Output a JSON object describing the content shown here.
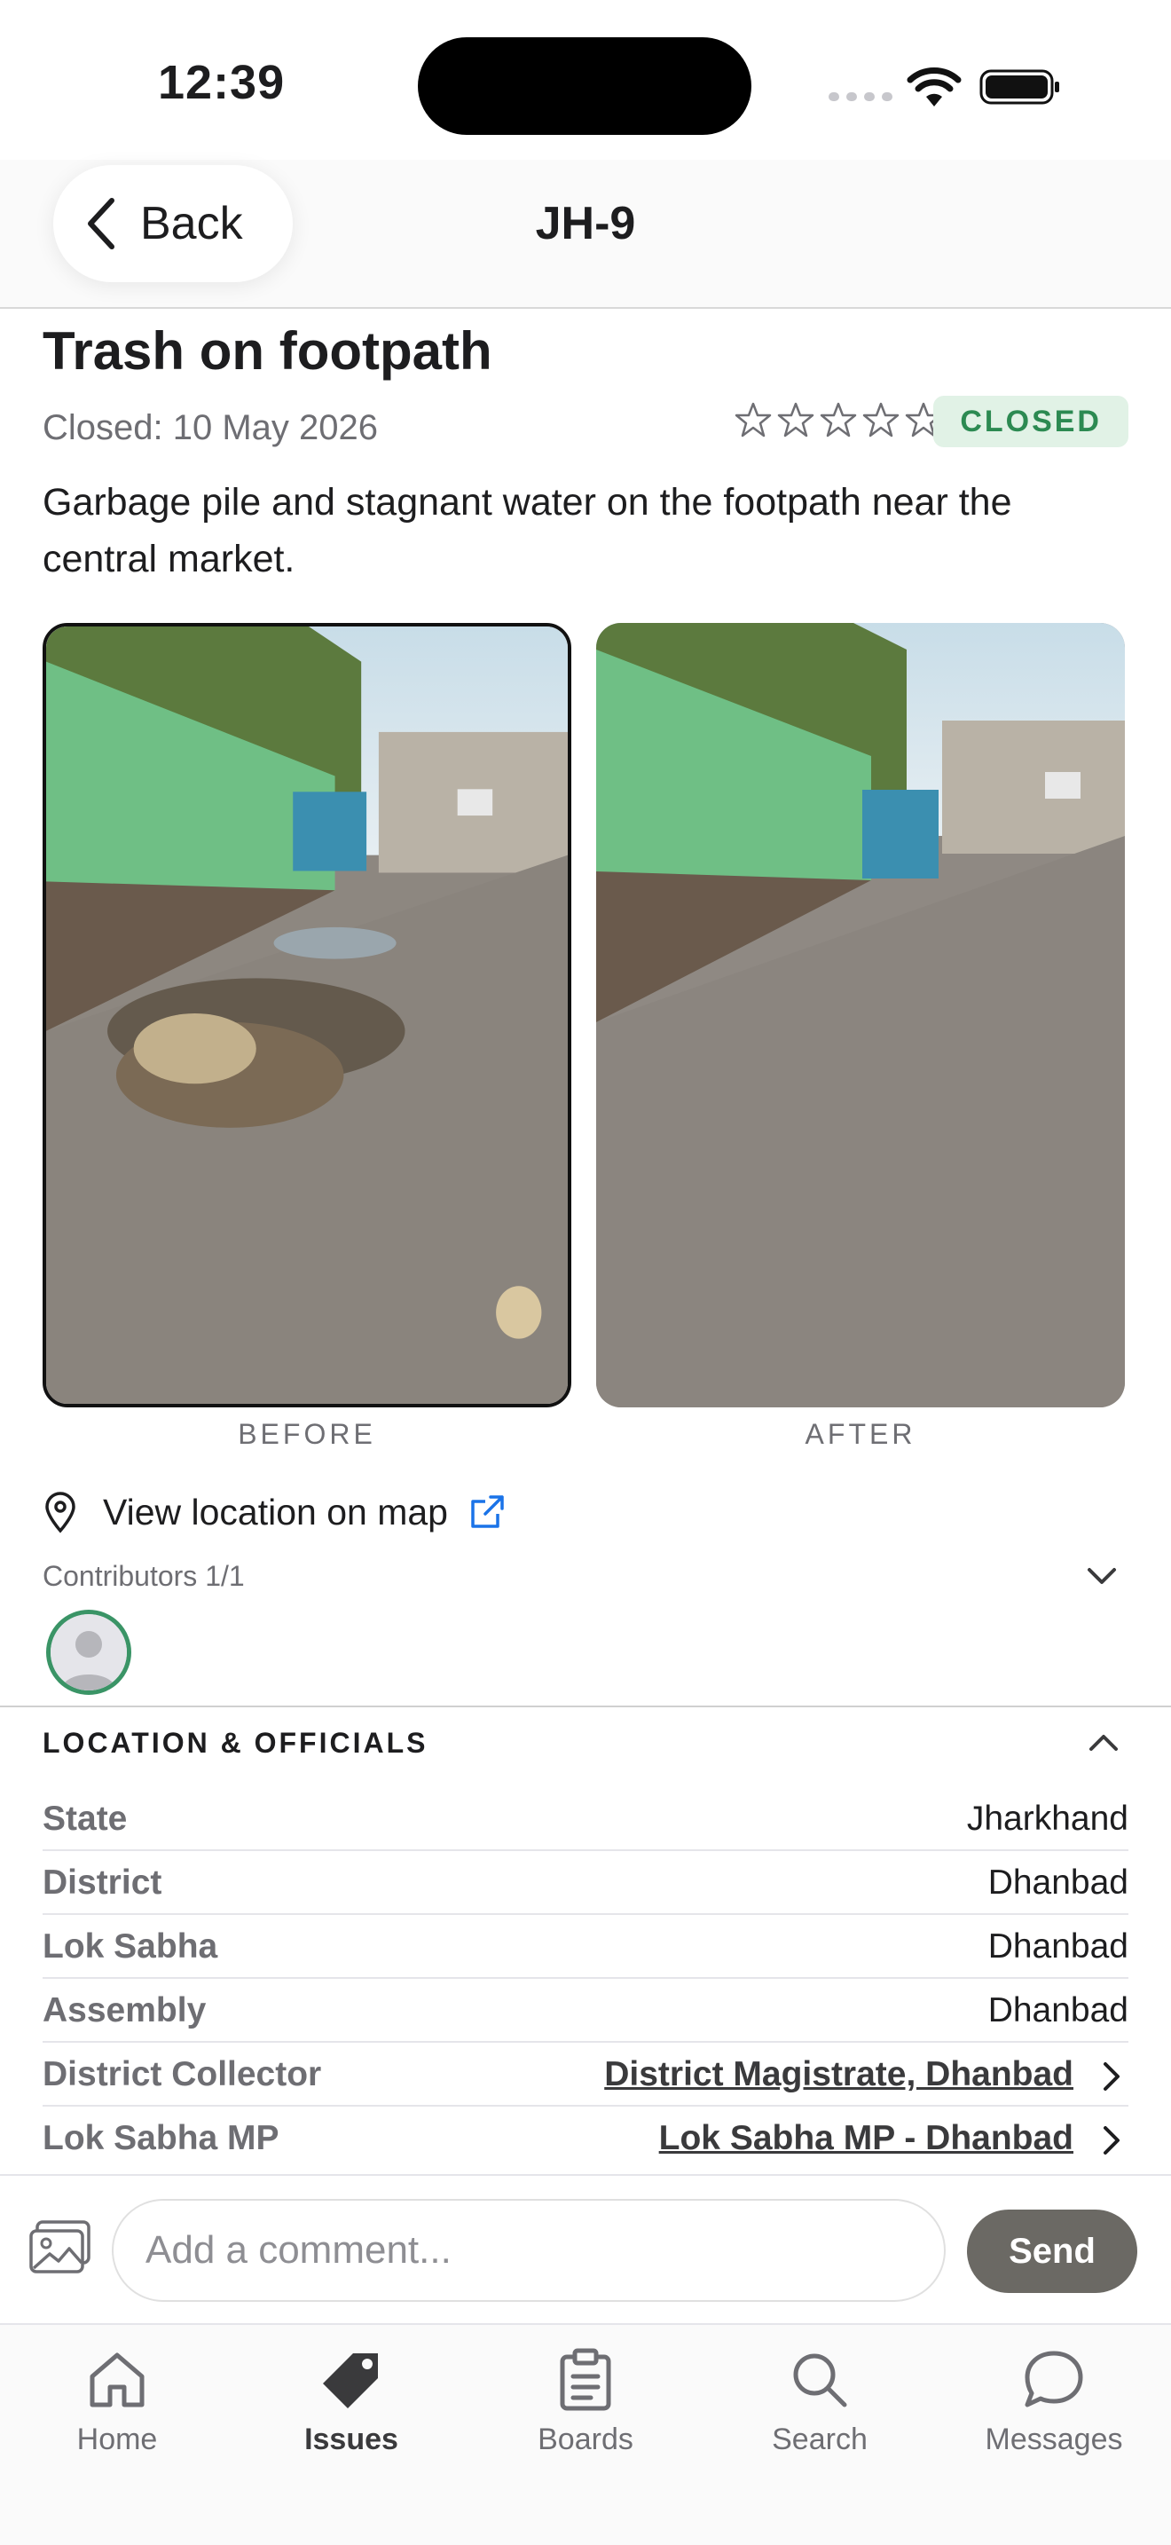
{
  "status_bar": {
    "time": "12:39"
  },
  "nav": {
    "back_label": "Back",
    "title": "JH-9"
  },
  "issue": {
    "title": "Trash on footpath",
    "closed_date": "Closed: 10 May 2026",
    "rating": 0,
    "rating_max": 5,
    "status": "CLOSED",
    "description": "Garbage pile and stagnant water on the footpath near the central market."
  },
  "photos": {
    "before_caption": "BEFORE",
    "after_caption": "AFTER"
  },
  "map_link": {
    "label": "View location on map"
  },
  "contributors": {
    "label": "Contributors 1/1"
  },
  "location_section": {
    "title": "LOCATION & OFFICIALS",
    "rows": [
      {
        "label": "State",
        "value": "Jharkhand"
      },
      {
        "label": "District",
        "value": "Dhanbad"
      },
      {
        "label": "Lok Sabha",
        "value": "Dhanbad"
      },
      {
        "label": "Assembly",
        "value": "Dhanbad"
      },
      {
        "label": "District Collector",
        "value": "District Magistrate, Dhanbad"
      },
      {
        "label": "Lok Sabha MP",
        "value": "Lok Sabha MP - Dhanbad"
      }
    ]
  },
  "comment": {
    "placeholder": "Add a comment...",
    "send_label": "Send"
  },
  "tabs": [
    {
      "label": "Home",
      "icon": "home-icon"
    },
    {
      "label": "Issues",
      "icon": "tag-icon"
    },
    {
      "label": "Boards",
      "icon": "clipboard-icon"
    },
    {
      "label": "Search",
      "icon": "search-icon"
    },
    {
      "label": "Messages",
      "icon": "chat-bubble-icon"
    }
  ],
  "colors": {
    "status_badge_bg": "#e1f2e6",
    "status_badge_text": "#2c8a52",
    "link_blue": "#1a73e8",
    "send_button": "#6b6964"
  }
}
